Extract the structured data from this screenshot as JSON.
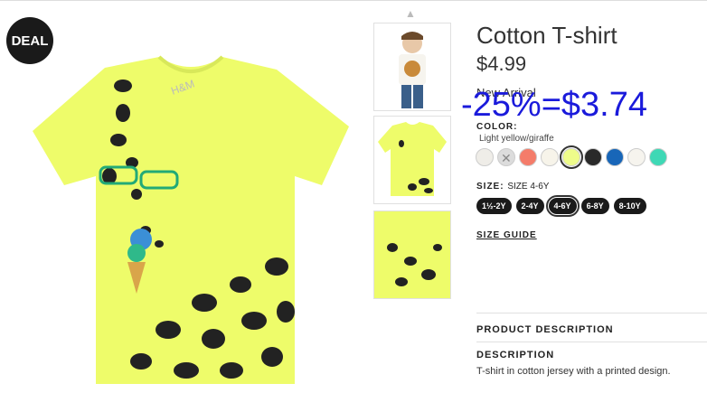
{
  "badge": {
    "deal": "DEAL"
  },
  "product": {
    "title": "Cotton T-shirt",
    "price": "$4.99",
    "new_arrival": "New Arrival",
    "deal_price": "-25%=$3.74",
    "deal_price_color": "#1a1adb",
    "tshirt_color": "#eefc6a",
    "print_brand": "H&M"
  },
  "color": {
    "label": "COLOR:",
    "selected_name": "Light yellow/giraffe",
    "swatches": [
      {
        "name": "off-white",
        "hex": "#efede8"
      },
      {
        "name": "grey-pattern",
        "hex": "#dcdcdc"
      },
      {
        "name": "coral",
        "hex": "#f47c6a"
      },
      {
        "name": "cream",
        "hex": "#f7f4ea"
      },
      {
        "name": "light-yellow",
        "hex": "#eefc8a"
      },
      {
        "name": "black",
        "hex": "#2a2a2a"
      },
      {
        "name": "blue",
        "hex": "#1866b8"
      },
      {
        "name": "white",
        "hex": "#f6f4ee"
      },
      {
        "name": "turquoise",
        "hex": "#3fd8b5"
      }
    ]
  },
  "size": {
    "label": "SIZE:",
    "selected": "SIZE 4-6Y",
    "options": [
      "1½-2Y",
      "2-4Y",
      "4-6Y",
      "6-8Y",
      "8-10Y"
    ]
  },
  "size_guide": "SIZE GUIDE",
  "product_description": {
    "heading": "PRODUCT DESCRIPTION",
    "description_label": "DESCRIPTION",
    "description_text": "T-shirt in cotton jersey with a printed design."
  }
}
